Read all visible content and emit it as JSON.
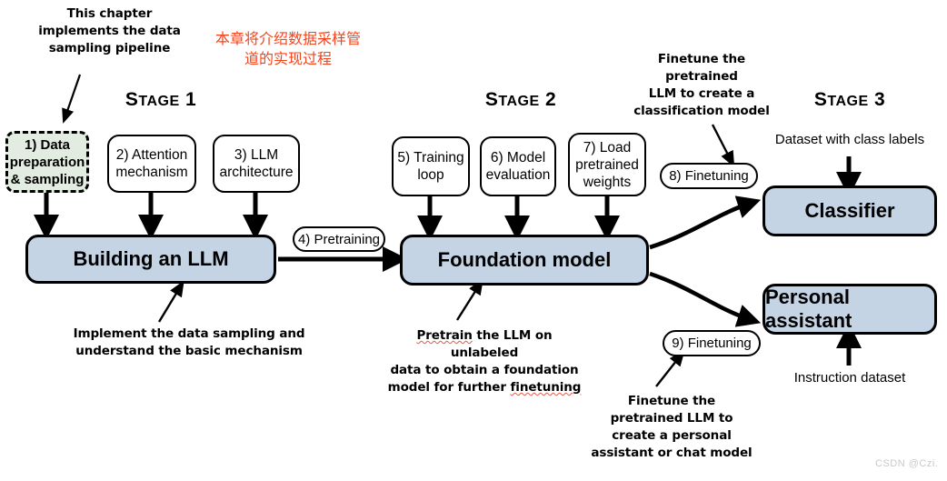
{
  "diagram": {
    "title": "Building an LLM - three stage pipeline",
    "colors": {
      "highlight_fill": "#e3ece1",
      "block_fill": "#c4d4e5",
      "stroke": "#000000",
      "chinese_text": "#f4441c",
      "watermark": "#c9c9c9"
    }
  },
  "stages": {
    "one": {
      "lead": "S",
      "rest": "TAGE",
      "num": "1"
    },
    "two": {
      "lead": "S",
      "rest": "TAGE",
      "num": "2"
    },
    "three": {
      "lead": "S",
      "rest": "TAGE",
      "num": "3"
    }
  },
  "annotations": {
    "top_left": "This chapter\nimplements the data\nsampling pipeline",
    "top_left_line1": "This chapter",
    "top_left_line2": "implements the data",
    "top_left_line3": "sampling pipeline",
    "chinese_line1": "本章将介绍数据采样管",
    "chinese_line2": "道的实现过程",
    "stage1_bottom_line1": "Implement the data sampling and",
    "stage1_bottom_line2": "understand the basic mechanism",
    "stage2_bottom_line1_a": "Pretrain",
    "stage2_bottom_line1_b": " the LLM on unlabeled",
    "stage2_bottom_line2": "data to obtain a foundation",
    "stage2_bottom_line3_a": "model for further ",
    "stage2_bottom_line3_b": "finetuning",
    "finetune_classifier_line1": "Finetune the pretrained",
    "finetune_classifier_line2": "LLM to create a",
    "finetune_classifier_line3": "classification model",
    "finetune_assistant_line1": "Finetune the",
    "finetune_assistant_line2": "pretrained LLM to",
    "finetune_assistant_line3": "create a personal",
    "finetune_assistant_line4": "assistant or chat model",
    "dataset_class_labels": "Dataset with class labels",
    "instruction_dataset": "Instruction dataset"
  },
  "boxes": {
    "step1_line1": "1) Data",
    "step1_line2": "preparation",
    "step1_line3": "& sampling",
    "step2_line1": "2) Attention",
    "step2_line2": "mechanism",
    "step3_line1": "3) LLM",
    "step3_line2": "architecture",
    "step5_line1": "5) Training",
    "step5_line2": "loop",
    "step6_line1": "6) Model",
    "step6_line2": "evaluation",
    "step7_line1": "7) Load",
    "step7_line2": "pretrained",
    "step7_line3": "weights",
    "building_llm": "Building an LLM",
    "foundation_model": "Foundation model",
    "classifier": "Classifier",
    "personal_assistant": "Personal assistant"
  },
  "pills": {
    "pretraining": "4) Pretraining",
    "finetuning_8": "8) Finetuning",
    "finetuning_9": "9) Finetuning"
  },
  "watermark": "CSDN @Czi."
}
